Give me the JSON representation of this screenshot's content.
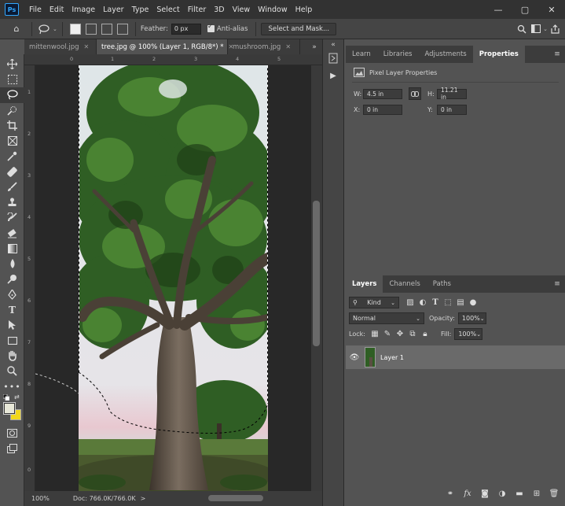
{
  "app": {
    "logo_text": "Ps"
  },
  "menu": [
    "File",
    "Edit",
    "Image",
    "Layer",
    "Type",
    "Select",
    "Filter",
    "3D",
    "View",
    "Window",
    "Help"
  ],
  "window_controls": {
    "minimize": "—",
    "maximize": "▢",
    "close": "✕"
  },
  "options_bar": {
    "feather_label": "Feather:",
    "feather_value": "0 px",
    "antialias_label": "Anti-alias",
    "select_mask_label": "Select and Mask..."
  },
  "tabs": [
    {
      "label": "mittenwool.jpg",
      "close": "✕"
    },
    {
      "label": "tree.jpg @ 100% (Layer 1, RGB/8*) *",
      "close": "✕"
    },
    {
      "label": "mushroom.jpg",
      "close": "✕"
    }
  ],
  "tabs_overflow": "»",
  "rulers": {
    "top": [
      "0",
      "1",
      "2",
      "3",
      "4",
      "5"
    ],
    "left": [
      "1",
      "2",
      "3",
      "4",
      "5",
      "6",
      "7",
      "8",
      "9",
      "0"
    ]
  },
  "status": {
    "zoom": "100%",
    "doc": "Doc: 766.0K/766.0K",
    "arrow": ">"
  },
  "properties_panel": {
    "tabs": [
      "Learn",
      "Libraries",
      "Adjustments",
      "Properties"
    ],
    "header": "Pixel Layer Properties",
    "w_label": "W:",
    "w_value": "4.5 in",
    "h_label": "H:",
    "h_value": "11.21 in",
    "x_label": "X:",
    "x_value": "0 in",
    "y_label": "Y:",
    "y_value": "0 in"
  },
  "layers_panel": {
    "tabs": [
      "Layers",
      "Channels",
      "Paths"
    ],
    "filter_kind": "Kind",
    "blend_mode": "Normal",
    "opacity_label": "Opacity:",
    "opacity_value": "100%",
    "lock_label": "Lock:",
    "fill_label": "Fill:",
    "fill_value": "100%",
    "layers": [
      {
        "name": "Layer 1",
        "visible": true
      }
    ]
  },
  "colors": {
    "foreground": "#e8e8d8",
    "background": "#f2d81c",
    "accent": "#31a8ff"
  }
}
